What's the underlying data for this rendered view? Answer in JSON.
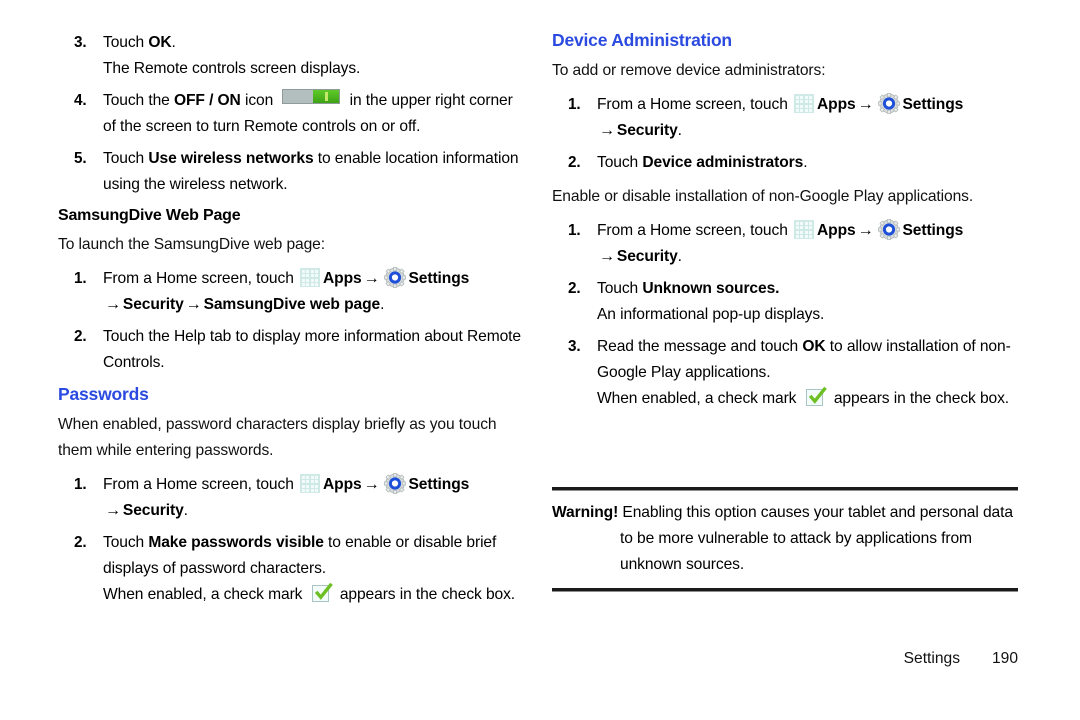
{
  "page": {
    "footer_label": "Settings",
    "footer_page": "190",
    "accent_heading_color": "#2a4ae0"
  },
  "left_column": {
    "steps_continued": [
      {
        "num": "3.",
        "text_before": "Touch ",
        "bold": "OK",
        "text_after": ".",
        "sub": "The Remote controls screen displays."
      },
      {
        "num": "4.",
        "text_before": "Touch the ",
        "bold": "OFF / ON",
        "text_mid": " icon ",
        "icon": "toggle-off-on-icon",
        "text_after": " in the upper right corner of the screen to turn Remote controls on or off."
      },
      {
        "num": "5.",
        "text_before": "Touch ",
        "bold": "Use wireless networks",
        "text_after": " to enable location information using the wireless network."
      }
    ],
    "samsungdive": {
      "heading": "SamsungDive Web Page",
      "intro": "To launch the SamsungDive web page:",
      "steps": [
        {
          "num": "1.",
          "text_before": "From a Home screen, touch ",
          "apps_label": "Apps",
          "arrow": "→",
          "settings_label": "Settings",
          "path_arrow": "→",
          "path_1": "Security",
          "path_arrow2": "→",
          "path_2": "SamsungDive web page",
          "path_end": "."
        },
        {
          "num": "2.",
          "text": "Touch the Help tab to display more information about Remote Controls."
        }
      ]
    },
    "passwords": {
      "heading": "Passwords",
      "intro": "When enabled, password characters display briefly as you touch them while entering passwords.",
      "steps": [
        {
          "num": "1.",
          "text_before": "From a Home screen, touch ",
          "apps_label": "Apps",
          "arrow": "→",
          "settings_label": "Settings",
          "path_arrow": "→",
          "path_1": "Security",
          "path_end": "."
        },
        {
          "num": "2.",
          "text_before": "Touch ",
          "bold": "Make passwords visible",
          "text_after": " to enable or disable brief displays of password characters.",
          "sub_before": "When enabled, a check mark ",
          "sub_icon": "check-mark-icon",
          "sub_after": " appears in the check box."
        }
      ]
    }
  },
  "right_column": {
    "device_administration": {
      "heading": "Device Administration",
      "intro": "To add or remove device administrators:",
      "steps": [
        {
          "num": "1.",
          "text_before": "From a Home screen, touch ",
          "apps_label": "Apps",
          "arrow": "→",
          "settings_label": "Settings",
          "path_arrow": "→",
          "path_1": "Security",
          "path_end": "."
        },
        {
          "num": "2.",
          "text_before": "Touch ",
          "bold": "Device administrators",
          "text_after": "."
        }
      ],
      "intro2": "Enable or disable installation of non-Google Play applications.",
      "steps2": [
        {
          "num": "1.",
          "text_before": "From a Home screen, touch ",
          "apps_label": "Apps",
          "arrow": "→",
          "settings_label": "Settings",
          "path_arrow": "→",
          "path_1": "Security",
          "path_end": "."
        },
        {
          "num": "2.",
          "text_before": "Touch ",
          "bold": "Unknown sources.",
          "text_after": "",
          "sub": "An informational pop-up displays."
        },
        {
          "num": "3.",
          "text_before": "Read the message and touch ",
          "bold": "OK",
          "text_after": " to allow installation of non-Google Play applications.",
          "sub_before": "When enabled, a check mark ",
          "sub_icon": "check-mark-icon",
          "sub_after": " appears in the check box."
        }
      ]
    },
    "warning": {
      "label": "Warning!",
      "text": "Enabling this option causes your tablet and personal data to be more vulnerable to attack by applications from unknown sources."
    }
  }
}
